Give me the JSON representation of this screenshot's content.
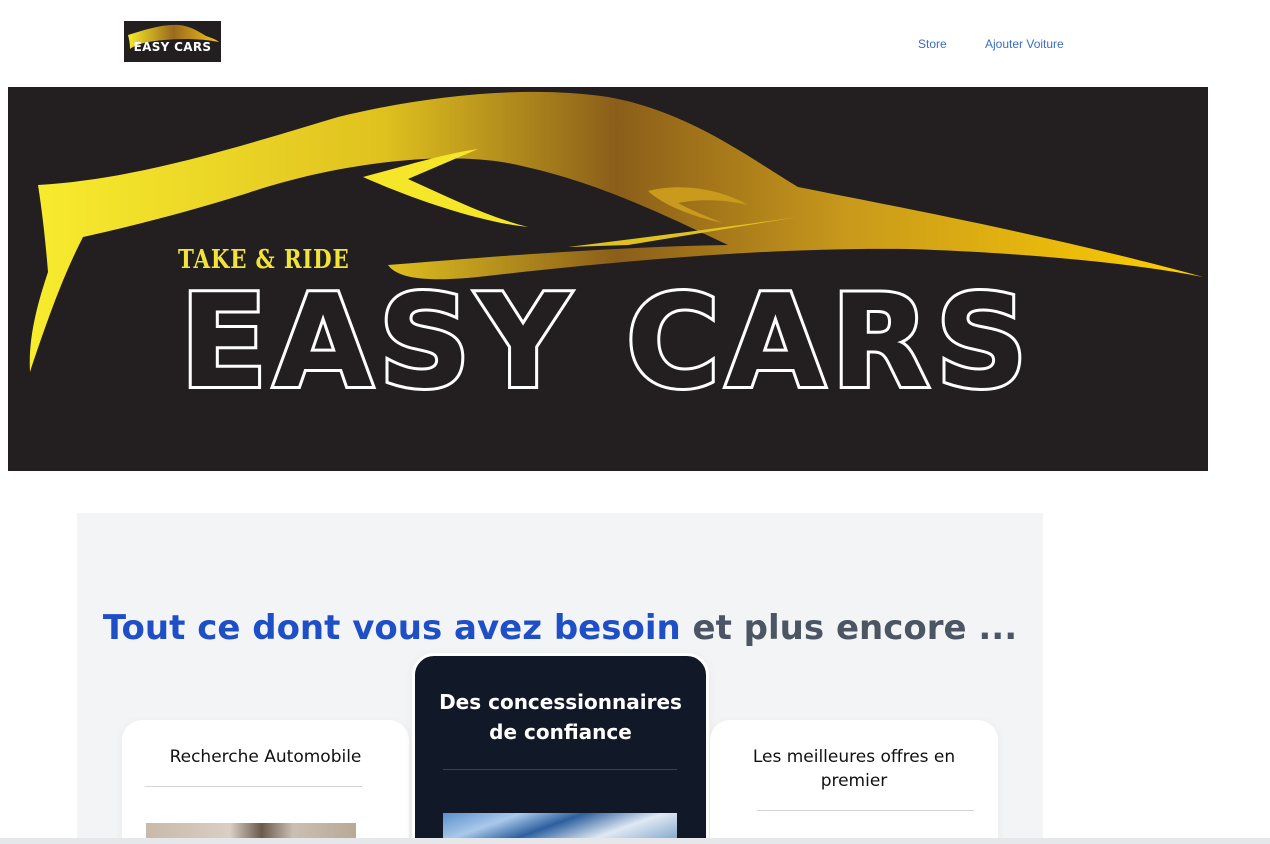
{
  "nav": {
    "logo_text": "EASY CARS",
    "links": [
      {
        "label": "Store"
      },
      {
        "label": "Ajouter Voiture"
      }
    ]
  },
  "hero": {
    "tagline": "TAKE & RIDE",
    "brand": "EASY CARS"
  },
  "features": {
    "title_accent": "Tout ce dont vous avez besoin",
    "title_rest": " et plus encore ...",
    "cards": [
      {
        "title": "Recherche Automobile"
      },
      {
        "title": "Des concessionnaires de confiance"
      },
      {
        "title": "Les meilleures offres en premier"
      }
    ]
  },
  "colors": {
    "accent": "#1f4fc7",
    "nav_link": "#3b6dc4",
    "hero_bg": "#231f20",
    "gold": "#d4a017",
    "dark_card": "#111827",
    "section_bg": "#f3f4f6"
  }
}
